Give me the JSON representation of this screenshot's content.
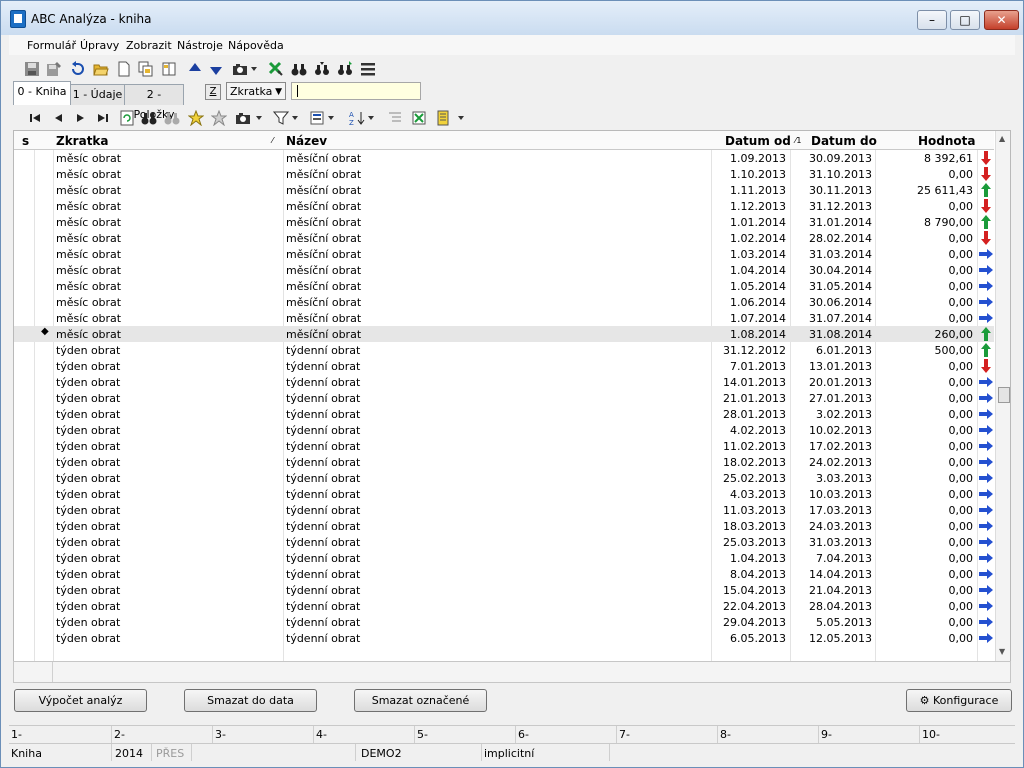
{
  "window": {
    "title": "ABC Analýza - kniha"
  },
  "menu": [
    "Formulář",
    "Úpravy",
    "Zobrazit",
    "Nástroje",
    "Nápověda"
  ],
  "tabs": [
    "0 - Kniha",
    "1 - Údaje",
    "2 - Položky"
  ],
  "filter": {
    "key_label": "Z",
    "combo_value": "Zkratka",
    "search_value": ""
  },
  "grid": {
    "headers": {
      "s": "s",
      "zkratka": "Zkratka",
      "nazev": "Název",
      "datum_od": "Datum od",
      "datum_do": "Datum do",
      "hodnota": "Hodnota"
    },
    "rows": [
      {
        "z": "měsíc obrat",
        "n": "měsíční obrat",
        "od": "1.09.2013",
        "do": "30.09.2013",
        "h": "8 392,61",
        "t": "down"
      },
      {
        "z": "měsíc obrat",
        "n": "měsíční obrat",
        "od": "1.10.2013",
        "do": "31.10.2013",
        "h": "0,00",
        "t": "down"
      },
      {
        "z": "měsíc obrat",
        "n": "měsíční obrat",
        "od": "1.11.2013",
        "do": "30.11.2013",
        "h": "25 611,43",
        "t": "up"
      },
      {
        "z": "měsíc obrat",
        "n": "měsíční obrat",
        "od": "1.12.2013",
        "do": "31.12.2013",
        "h": "0,00",
        "t": "down"
      },
      {
        "z": "měsíc obrat",
        "n": "měsíční obrat",
        "od": "1.01.2014",
        "do": "31.01.2014",
        "h": "8 790,00",
        "t": "up"
      },
      {
        "z": "měsíc obrat",
        "n": "měsíční obrat",
        "od": "1.02.2014",
        "do": "28.02.2014",
        "h": "0,00",
        "t": "down"
      },
      {
        "z": "měsíc obrat",
        "n": "měsíční obrat",
        "od": "1.03.2014",
        "do": "31.03.2014",
        "h": "0,00",
        "t": "right"
      },
      {
        "z": "měsíc obrat",
        "n": "měsíční obrat",
        "od": "1.04.2014",
        "do": "30.04.2014",
        "h": "0,00",
        "t": "right"
      },
      {
        "z": "měsíc obrat",
        "n": "měsíční obrat",
        "od": "1.05.2014",
        "do": "31.05.2014",
        "h": "0,00",
        "t": "right"
      },
      {
        "z": "měsíc obrat",
        "n": "měsíční obrat",
        "od": "1.06.2014",
        "do": "30.06.2014",
        "h": "0,00",
        "t": "right"
      },
      {
        "z": "měsíc obrat",
        "n": "měsíční obrat",
        "od": "1.07.2014",
        "do": "31.07.2014",
        "h": "0,00",
        "t": "right"
      },
      {
        "z": "měsíc obrat",
        "n": "měsíční obrat",
        "od": "1.08.2014",
        "do": "31.08.2014",
        "h": "260,00",
        "t": "up",
        "sel": true
      },
      {
        "z": "týden obrat",
        "n": "týdenní obrat",
        "od": "31.12.2012",
        "do": "6.01.2013",
        "h": "500,00",
        "t": "up"
      },
      {
        "z": "týden obrat",
        "n": "týdenní obrat",
        "od": "7.01.2013",
        "do": "13.01.2013",
        "h": "0,00",
        "t": "down"
      },
      {
        "z": "týden obrat",
        "n": "týdenní obrat",
        "od": "14.01.2013",
        "do": "20.01.2013",
        "h": "0,00",
        "t": "right"
      },
      {
        "z": "týden obrat",
        "n": "týdenní obrat",
        "od": "21.01.2013",
        "do": "27.01.2013",
        "h": "0,00",
        "t": "right"
      },
      {
        "z": "týden obrat",
        "n": "týdenní obrat",
        "od": "28.01.2013",
        "do": "3.02.2013",
        "h": "0,00",
        "t": "right"
      },
      {
        "z": "týden obrat",
        "n": "týdenní obrat",
        "od": "4.02.2013",
        "do": "10.02.2013",
        "h": "0,00",
        "t": "right"
      },
      {
        "z": "týden obrat",
        "n": "týdenní obrat",
        "od": "11.02.2013",
        "do": "17.02.2013",
        "h": "0,00",
        "t": "right"
      },
      {
        "z": "týden obrat",
        "n": "týdenní obrat",
        "od": "18.02.2013",
        "do": "24.02.2013",
        "h": "0,00",
        "t": "right"
      },
      {
        "z": "týden obrat",
        "n": "týdenní obrat",
        "od": "25.02.2013",
        "do": "3.03.2013",
        "h": "0,00",
        "t": "right"
      },
      {
        "z": "týden obrat",
        "n": "týdenní obrat",
        "od": "4.03.2013",
        "do": "10.03.2013",
        "h": "0,00",
        "t": "right"
      },
      {
        "z": "týden obrat",
        "n": "týdenní obrat",
        "od": "11.03.2013",
        "do": "17.03.2013",
        "h": "0,00",
        "t": "right"
      },
      {
        "z": "týden obrat",
        "n": "týdenní obrat",
        "od": "18.03.2013",
        "do": "24.03.2013",
        "h": "0,00",
        "t": "right"
      },
      {
        "z": "týden obrat",
        "n": "týdenní obrat",
        "od": "25.03.2013",
        "do": "31.03.2013",
        "h": "0,00",
        "t": "right"
      },
      {
        "z": "týden obrat",
        "n": "týdenní obrat",
        "od": "1.04.2013",
        "do": "7.04.2013",
        "h": "0,00",
        "t": "right"
      },
      {
        "z": "týden obrat",
        "n": "týdenní obrat",
        "od": "8.04.2013",
        "do": "14.04.2013",
        "h": "0,00",
        "t": "right"
      },
      {
        "z": "týden obrat",
        "n": "týdenní obrat",
        "od": "15.04.2013",
        "do": "21.04.2013",
        "h": "0,00",
        "t": "right"
      },
      {
        "z": "týden obrat",
        "n": "týdenní obrat",
        "od": "22.04.2013",
        "do": "28.04.2013",
        "h": "0,00",
        "t": "right"
      },
      {
        "z": "týden obrat",
        "n": "týdenní obrat",
        "od": "29.04.2013",
        "do": "5.05.2013",
        "h": "0,00",
        "t": "right"
      },
      {
        "z": "týden obrat",
        "n": "týdenní obrat",
        "od": "6.05.2013",
        "do": "12.05.2013",
        "h": "0,00",
        "t": "right"
      }
    ]
  },
  "buttons": {
    "vypocet": "Výpočet analýz",
    "smazat_data": "Smazat do data",
    "smazat_oznacene": "Smazat označené",
    "konfigurace": "Konfigurace"
  },
  "fkeys": [
    "1-",
    "2-",
    "3-",
    "4-",
    "5-",
    "6-",
    "7-",
    "8-",
    "9-",
    "10-"
  ],
  "status": {
    "form": "Kniha",
    "year": "2014",
    "mode": "PŘES",
    "db": "DEMO2",
    "profile": "implicitní"
  },
  "colors": {
    "trend_up": "#1a9b3a",
    "trend_down": "#d42020",
    "trend_right": "#2450d0"
  }
}
